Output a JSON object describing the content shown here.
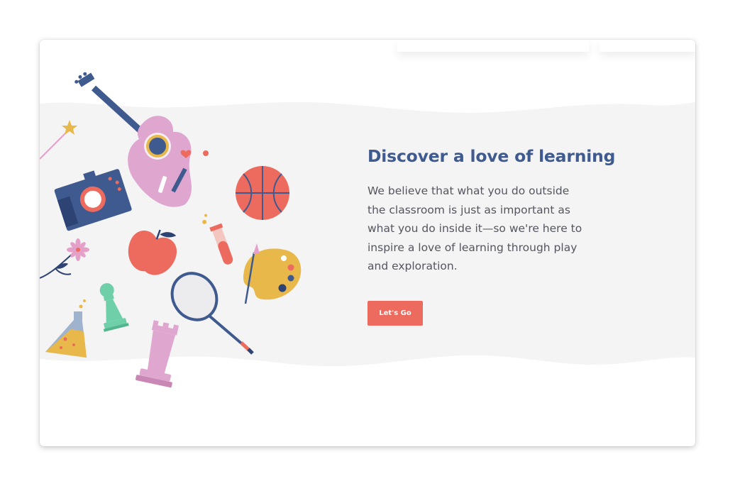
{
  "hero": {
    "headline": "Discover a love of learning",
    "body": "We believe that what you do outside the classroom is just as important as what you do inside it—so we're here to inspire a love of learning through play and exploration.",
    "cta_label": "Let's Go"
  },
  "illustration_items": [
    "wand-star-icon",
    "guitar-icon",
    "camera-icon",
    "basketball-icon",
    "apple-icon",
    "test-tube-icon",
    "flower-icon",
    "paint-palette-icon",
    "badminton-racket-icon",
    "chemistry-flask-icon",
    "chess-pawn-icon",
    "chess-rook-icon"
  ],
  "colors": {
    "accent": "#ec6a5e",
    "heading": "#3f5a8e",
    "band": "#f4f4f4",
    "text": "#555560"
  }
}
